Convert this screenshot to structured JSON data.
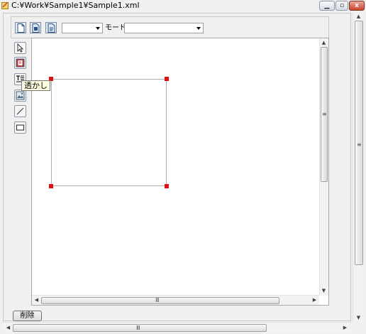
{
  "window": {
    "title": "C:¥Work¥Sample1¥Sample1.xml",
    "min_glyph": "▁",
    "max_glyph": "▫",
    "close_glyph": "x"
  },
  "toolbar": {
    "buttons": [
      "new-page-icon",
      "page-icon",
      "page-alt-icon"
    ],
    "combo1_value": "",
    "mode_label": "モード",
    "mode_value": ""
  },
  "tools": [
    {
      "name": "pointer-tool-icon"
    },
    {
      "name": "stamp-tool-icon"
    },
    {
      "name": "text-tool-icon"
    },
    {
      "name": "image-tool-icon"
    },
    {
      "name": "line-tool-icon"
    },
    {
      "name": "rectangle-tool-icon"
    }
  ],
  "tooltip": {
    "text": "透かし"
  },
  "canvas": {
    "selected_shape": "rectangle",
    "handle_color": "#e01010"
  },
  "scroll": {
    "up": "▲",
    "down": "▼",
    "left": "◀",
    "right": "▶",
    "grip_v": "≡",
    "grip_h": "Ⅲ"
  },
  "footer": {
    "delete_label": "削除"
  }
}
